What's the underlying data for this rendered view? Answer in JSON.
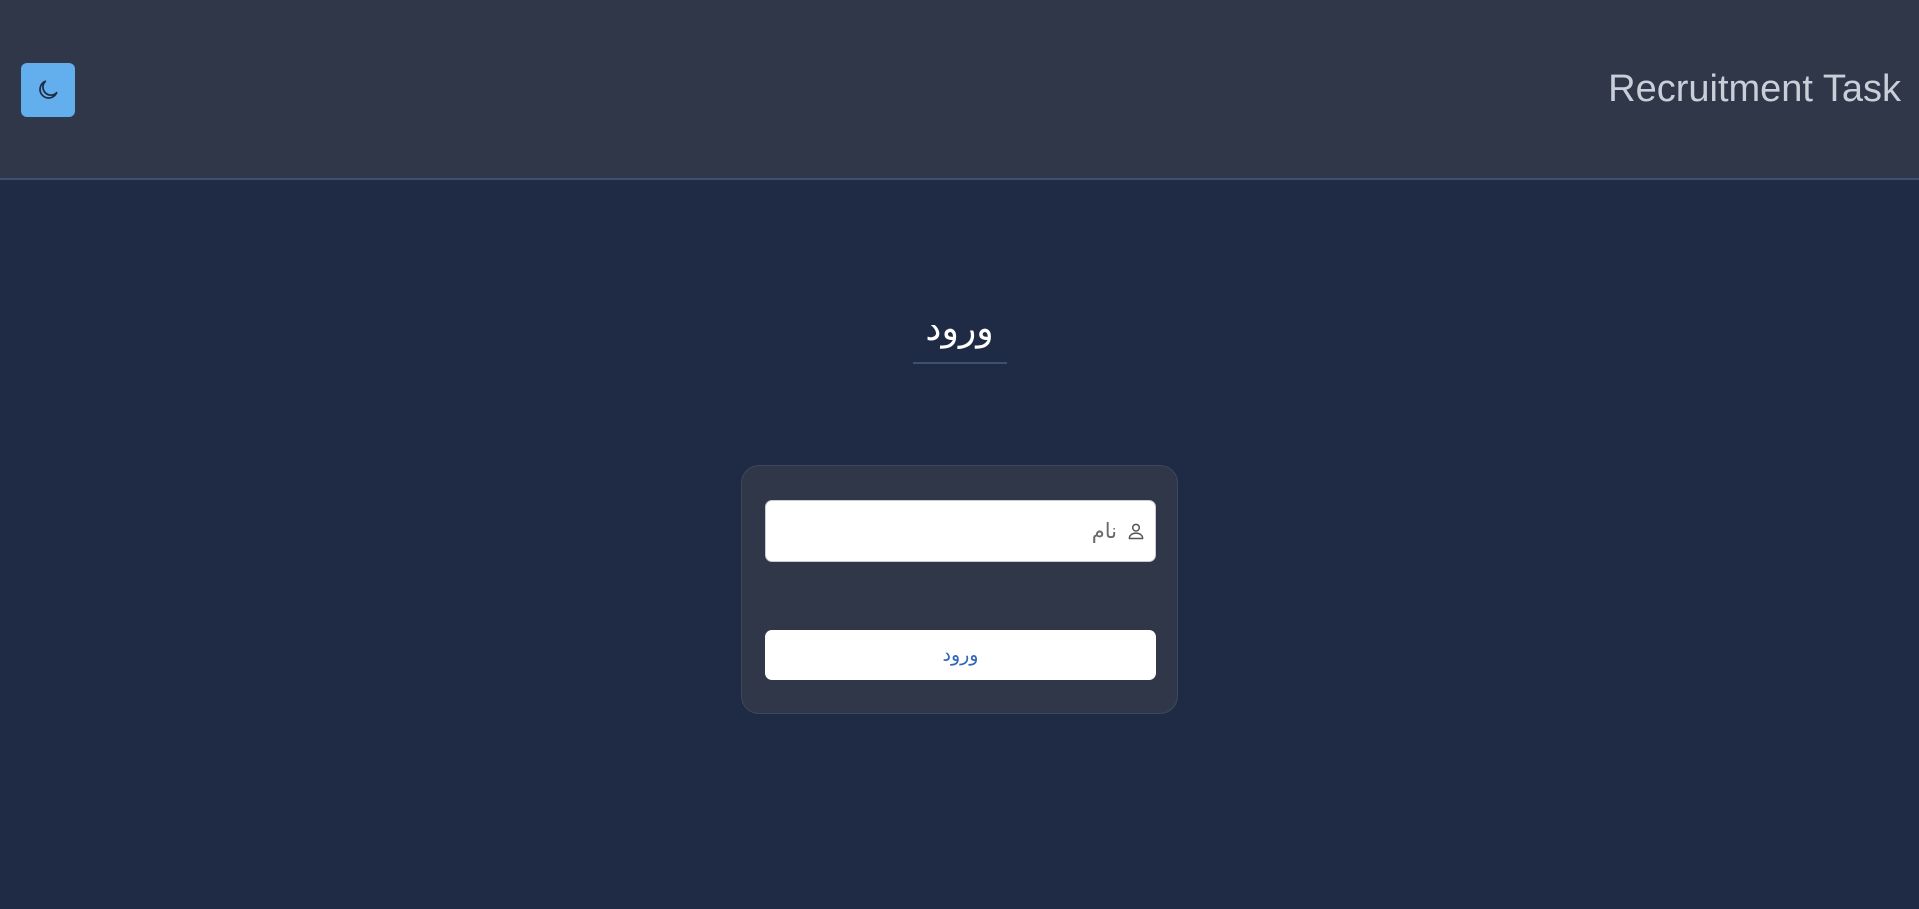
{
  "header": {
    "app_title": "Recruitment Task",
    "theme_toggle_icon": "moon-icon",
    "accent_color": "#63aeec"
  },
  "main": {
    "heading": "ورود",
    "form": {
      "name_field": {
        "value": "",
        "placeholder": "نام",
        "icon": "user-icon"
      },
      "submit_label": "ورود"
    }
  }
}
